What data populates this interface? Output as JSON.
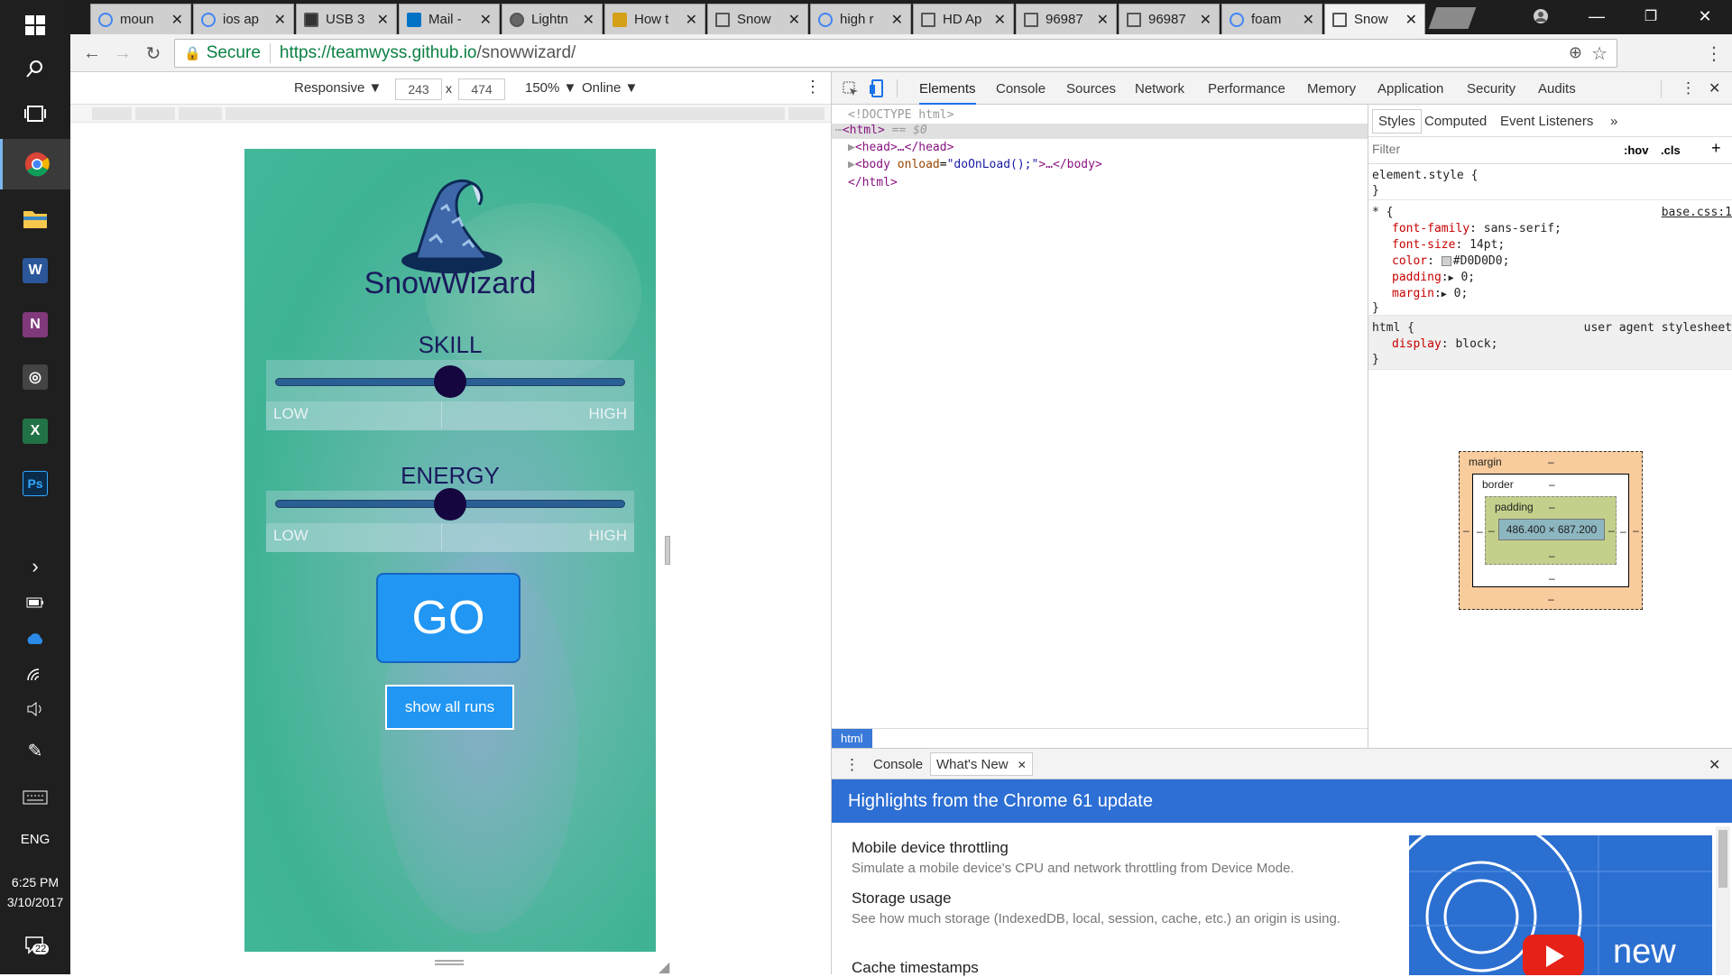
{
  "taskbar": {
    "language": "ENG",
    "time": "6:25 PM",
    "date": "3/10/2017",
    "notification_count": "22",
    "apps": [
      {
        "name": "chrome",
        "glyph": "",
        "color": "#4caf50"
      },
      {
        "name": "file-explorer",
        "glyph": "",
        "color": "#f6c84b"
      },
      {
        "name": "word",
        "glyph": "W",
        "color": "#2b579a"
      },
      {
        "name": "onenote",
        "glyph": "N",
        "color": "#80397b"
      },
      {
        "name": "camera",
        "glyph": "◎",
        "color": "#444444"
      },
      {
        "name": "excel",
        "glyph": "X",
        "color": "#217346"
      },
      {
        "name": "photoshop",
        "glyph": "Ps",
        "color": "#0a2b4a"
      }
    ]
  },
  "tabs": [
    {
      "title": "moun",
      "fav": "#4285f4"
    },
    {
      "title": "ios ap",
      "fav": "#4285f4"
    },
    {
      "title": "USB 3",
      "fav": "#333333"
    },
    {
      "title": "Mail -",
      "fav": "#0072c6"
    },
    {
      "title": "Lightn",
      "fav": "#666666"
    },
    {
      "title": "How t",
      "fav": "#d4a017"
    },
    {
      "title": "Snow",
      "fav": "#888888"
    },
    {
      "title": "high r",
      "fav": "#4285f4"
    },
    {
      "title": "HD Ap",
      "fav": "#888888"
    },
    {
      "title": "96987",
      "fav": "#888888"
    },
    {
      "title": "96987",
      "fav": "#888888"
    },
    {
      "title": "foam",
      "fav": "#4285f4"
    },
    {
      "title": "Snow",
      "fav": "#888888",
      "active": true
    }
  ],
  "address": {
    "secure_label": "Secure",
    "url_host": "https://teamwyss.github.io",
    "url_path": "/snowwizard/"
  },
  "device_toolbar": {
    "device": "Responsive ▼",
    "width": "243",
    "times": "x",
    "height": "474",
    "zoom": "150% ▼",
    "network": "Online ▼"
  },
  "app": {
    "logo_text": "SnowWizard",
    "skill": {
      "label": "SKILL",
      "low": "LOW",
      "high": "HIGH",
      "value": 0.5
    },
    "energy": {
      "label": "ENERGY",
      "low": "LOW",
      "high": "HIGH",
      "value": 0.5
    },
    "go_label": "GO",
    "show_runs_label": "show all runs"
  },
  "devtools": {
    "tabs": [
      "Elements",
      "Console",
      "Sources",
      "Network",
      "Performance",
      "Memory",
      "Application",
      "Security",
      "Audits"
    ],
    "dom": {
      "doctype": "<!DOCTYPE html>",
      "html_open": "<html>",
      "html_selected_suffix": " == $0",
      "head": "<head>…</head>",
      "body_tag": "<body ",
      "body_attr": "onload",
      "body_val": "\"doOnLoad();\"",
      "body_rest": ">…</body>",
      "html_close": "</html>",
      "breadcrumb": "html"
    },
    "styles_tabs": [
      "Styles",
      "Computed",
      "Event Listeners",
      "»"
    ],
    "filter_placeholder": "Filter",
    "hov": ":hov",
    "cls": ".cls",
    "element_style": "element.style {",
    "star_rule": {
      "selector": "* {",
      "source": "base.css:1",
      "props": [
        {
          "name": "font-family",
          "value": "sans-serif;"
        },
        {
          "name": "font-size",
          "value": "14pt;"
        },
        {
          "name": "color",
          "value": "#D0D0D0;"
        },
        {
          "name": "padding",
          "value": "0;"
        },
        {
          "name": "margin",
          "value": "0;"
        }
      ]
    },
    "html_rule": {
      "selector": "html {",
      "source": "user agent stylesheet",
      "prop": "display",
      "value": "block;"
    },
    "box_model": {
      "margin": "margin",
      "border": "border",
      "padding": "padding",
      "dash": "–",
      "content": "486.400 × 687.200"
    },
    "drawer": {
      "tabs": [
        "Console",
        "What's New"
      ],
      "banner": "Highlights from the Chrome 61 update",
      "features": [
        {
          "title": "Mobile device throttling",
          "desc": "Simulate a mobile device's CPU and network throttling from Device Mode."
        },
        {
          "title": "Storage usage",
          "desc": "See how much storage (IndexedDB, local, session, cache, etc.) an origin is using."
        },
        {
          "title": "Cache timestamps",
          "desc": ""
        }
      ],
      "video_text": "new"
    }
  }
}
